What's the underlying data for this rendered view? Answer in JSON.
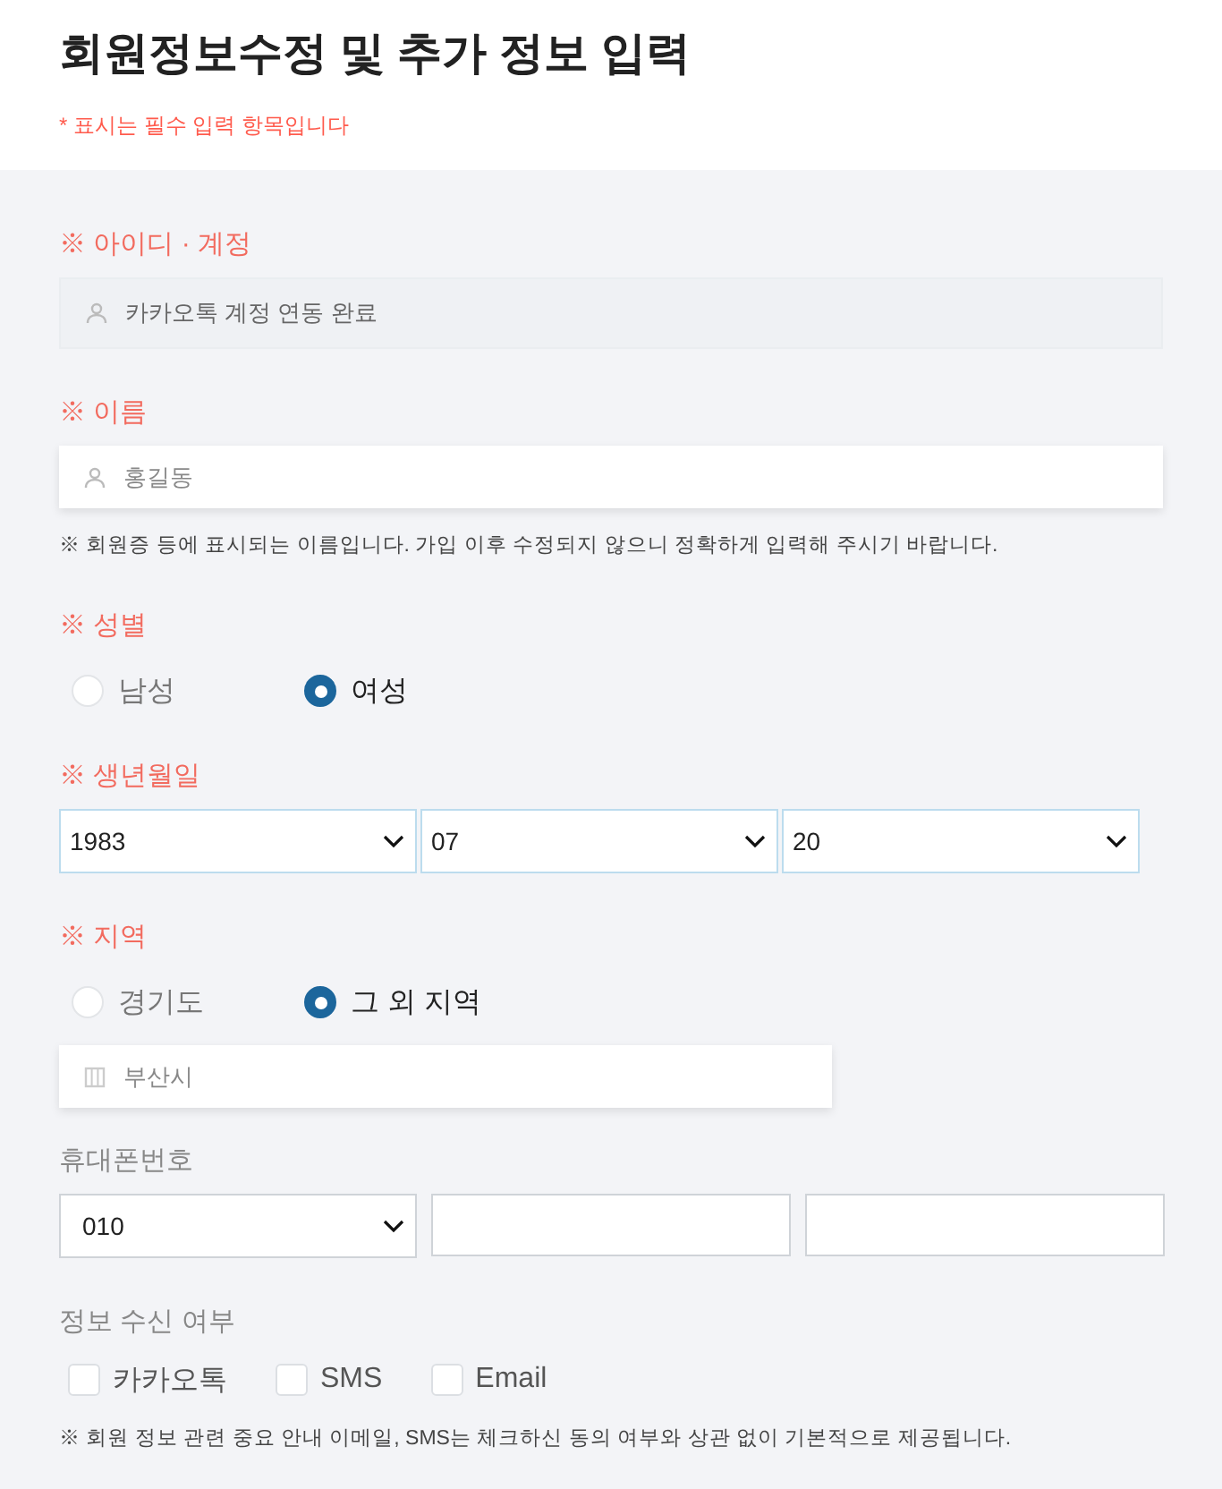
{
  "header": {
    "title": "회원정보수정 및 추가 정보 입력",
    "note": "* 표시는 필수 입력 항목입니다"
  },
  "sections": [
    {
      "kind": "text",
      "label": "※ 아이디 · 계정",
      "required": true,
      "field": {
        "value": "카카오톡 계정 연동 완료",
        "disabled": true
      }
    },
    {
      "kind": "text",
      "label": "※ 이름",
      "required": true,
      "field": {
        "value": "홍길동",
        "disabled": false
      },
      "help": "※ 회원증 등에 표시되는 이름입니다. 가입 이후 수정되지 않으니 정확하게 입력해 주시기 바랍니다."
    },
    {
      "kind": "radio",
      "label": "※ 성별",
      "required": true,
      "options": [
        {
          "label": "남성",
          "selected": false
        },
        {
          "label": "여성",
          "selected": true
        }
      ]
    },
    {
      "kind": "selects",
      "label": "※ 생년월일",
      "required": true,
      "selects": [
        "1983",
        "07",
        "20"
      ]
    },
    {
      "kind": "radio",
      "label": "※ 지역",
      "required": true,
      "options": [
        {
          "label": "경기도",
          "selected": false
        },
        {
          "label": "그 외 지역",
          "selected": true
        }
      ],
      "field": {
        "value": "부산시",
        "disabled": false
      }
    },
    {
      "kind": "phone",
      "label": "휴대폰번호",
      "required": false,
      "select": "010"
    },
    {
      "kind": "checks",
      "label": "정보 수신 여부",
      "required": false,
      "options": [
        {
          "label": "카카오톡",
          "checked": false
        },
        {
          "label": "SMS",
          "checked": false
        },
        {
          "label": "Email",
          "checked": false
        }
      ],
      "help": "※ 회원 정보 관련 중요 안내 이메일, SMS는 체크하신 동의 여부와 상관 없이 기본적으로 제공됩니다."
    }
  ]
}
